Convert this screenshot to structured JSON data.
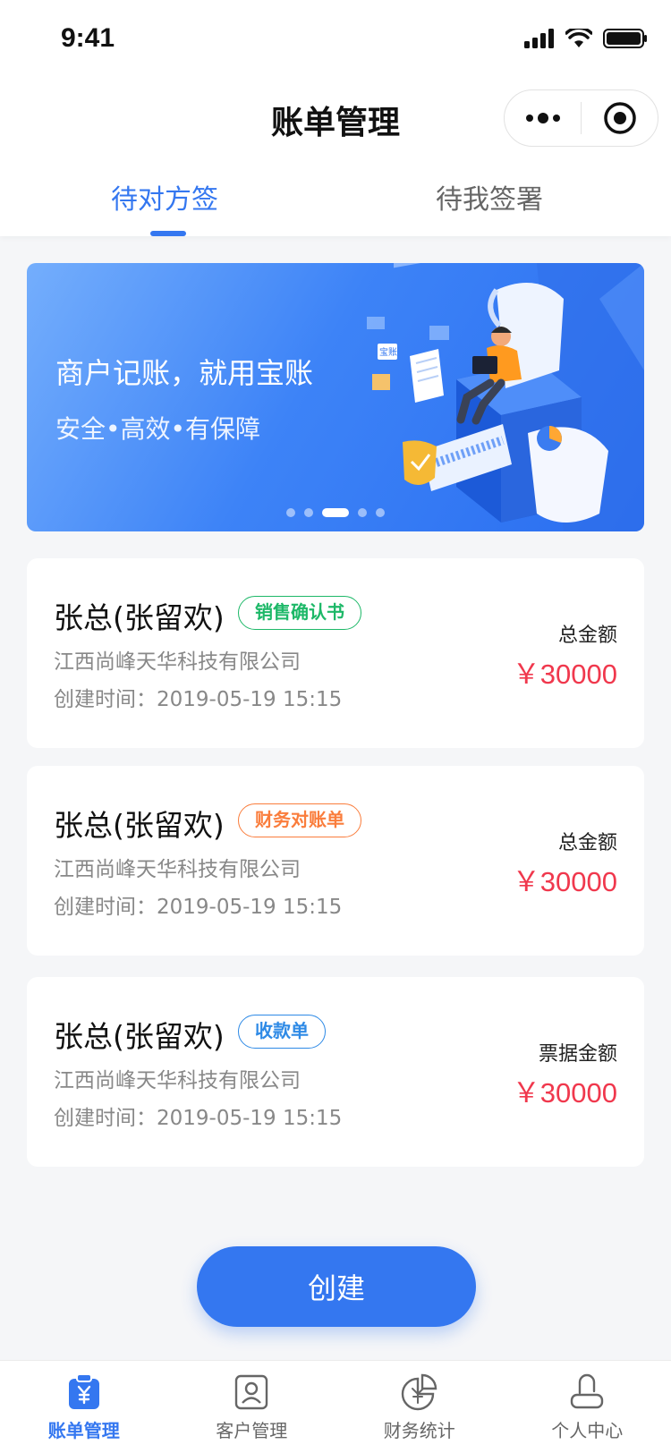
{
  "status_bar": {
    "time": "9:41"
  },
  "header": {
    "title": "账单管理"
  },
  "tabs": [
    {
      "label": "待对方签",
      "active": true
    },
    {
      "label": "待我签署",
      "active": false
    }
  ],
  "banner": {
    "title": "商户记账，就用宝账",
    "subtitle": "安全•高效•有保障",
    "art_badge": "宝账",
    "active_dot_index": 2,
    "dot_count": 5
  },
  "cards": [
    {
      "name": "张总(张留欢)",
      "tag": "销售确认书",
      "tag_color": "#1db868",
      "company": "江西尚峰天华科技有限公司",
      "created": "创建时间：2019-05-19 15:15",
      "amount_label": "总金额",
      "amount": "￥30000"
    },
    {
      "name": "张总(张留欢)",
      "tag": "财务对账单",
      "tag_color": "#fa7d3c",
      "company": "江西尚峰天华科技有限公司",
      "created": "创建时间：2019-05-19 15:15",
      "amount_label": "总金额",
      "amount": "￥30000"
    },
    {
      "name": "张总(张留欢)",
      "tag": "收款单",
      "tag_color": "#2e8ae6",
      "company": "江西尚峰天华科技有限公司",
      "created": "创建时间：2019-05-19 15:15",
      "amount_label": "票据金额",
      "amount": "￥30000"
    }
  ],
  "create_button": {
    "label": "创建"
  },
  "bottom_nav": [
    {
      "label": "账单管理",
      "icon": "bill-icon",
      "active": true
    },
    {
      "label": "客户管理",
      "icon": "customer-icon",
      "active": false
    },
    {
      "label": "财务统计",
      "icon": "finance-stats-icon",
      "active": false
    },
    {
      "label": "个人中心",
      "icon": "profile-icon",
      "active": false
    }
  ],
  "colors": {
    "primary": "#3477f0",
    "amount": "#f0384d",
    "background": "#f5f6f8"
  }
}
